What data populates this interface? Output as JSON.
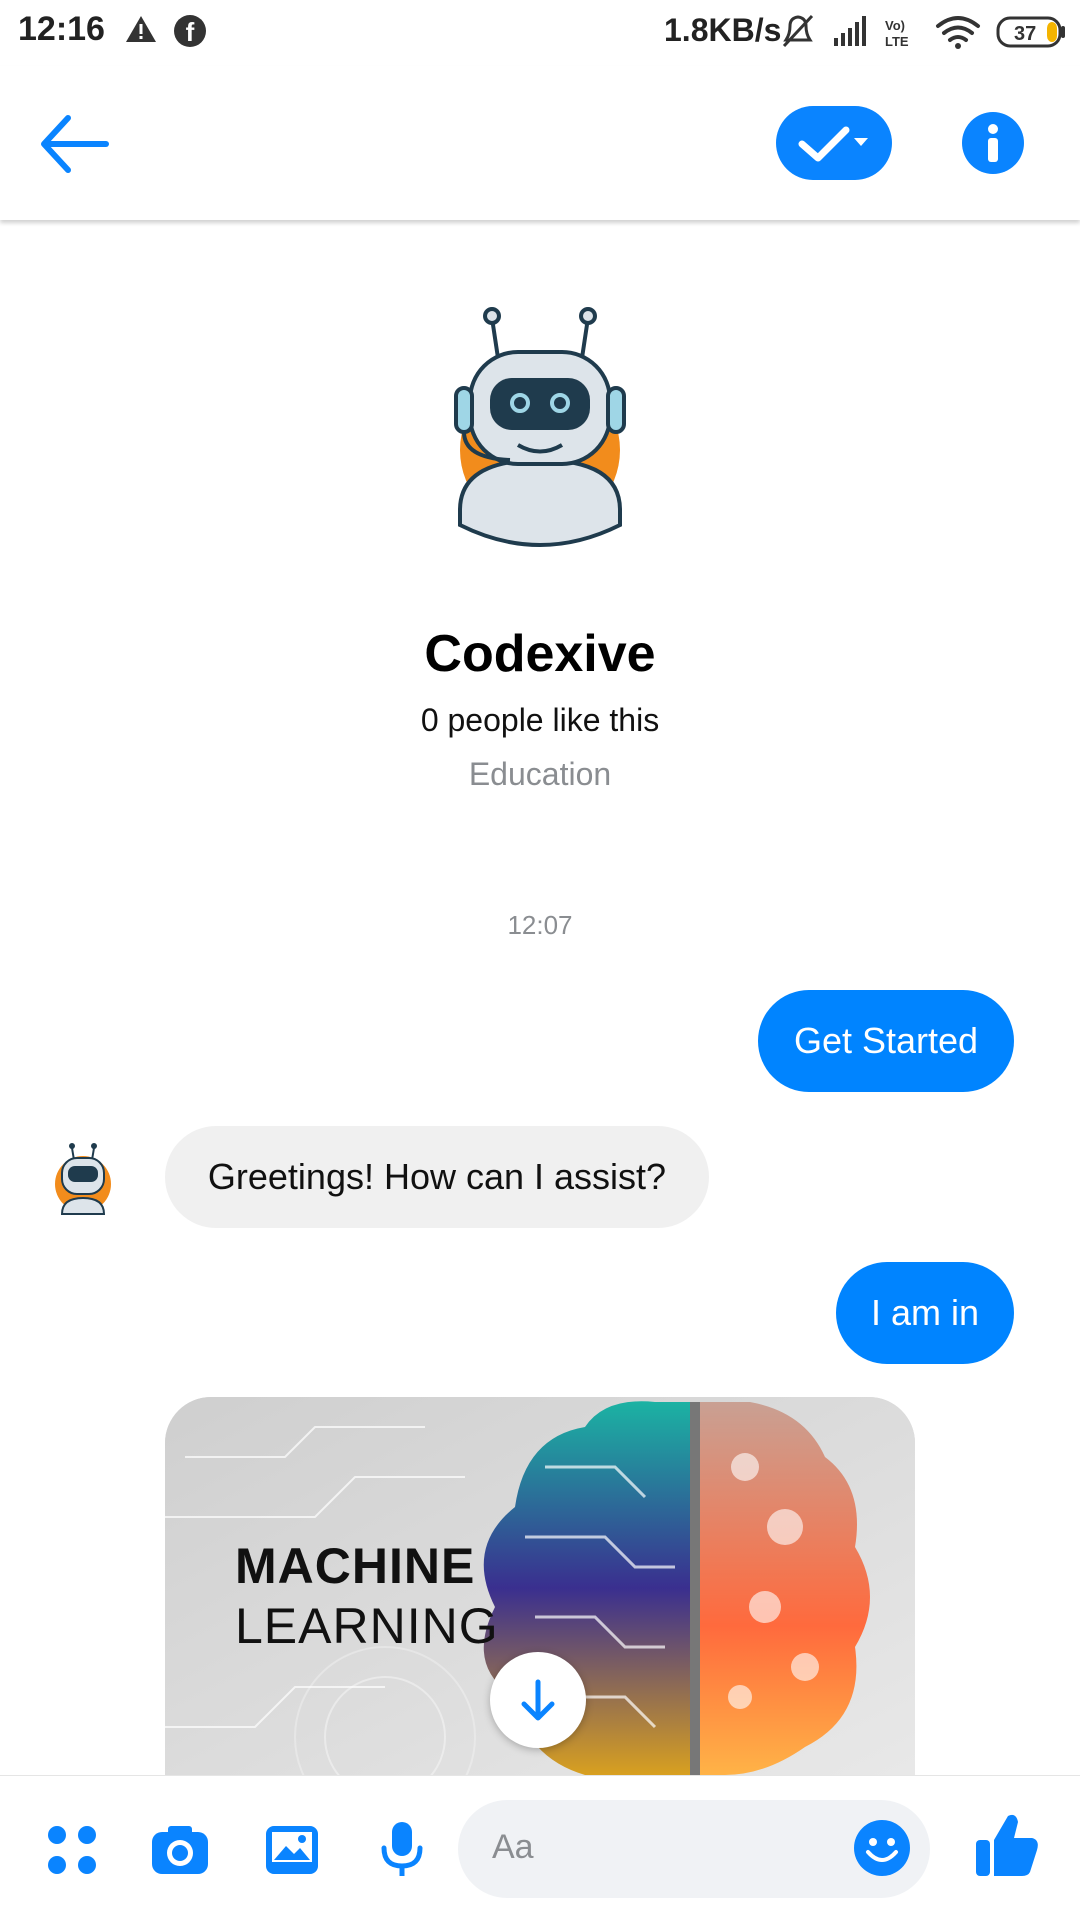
{
  "status_bar": {
    "time": "12:16",
    "speed": "1.8KB/s",
    "battery": "37",
    "network_label": "Vo) LTE"
  },
  "header": {
    "back_icon": "arrow-left-icon",
    "check_icon": "check-dropdown-icon",
    "info_icon": "info-icon",
    "accent_color": "#0a84ff"
  },
  "profile": {
    "name": "Codexive",
    "likes": "0 people like this",
    "category": "Education"
  },
  "conversation": {
    "timestamp": "12:07",
    "messages": [
      {
        "from": "me",
        "text": "Get Started"
      },
      {
        "from": "bot",
        "text": "Greetings! How can I assist?"
      },
      {
        "from": "me",
        "text": "I am in"
      }
    ],
    "image_card": {
      "line1": "MACHINE",
      "line2": "LEARNING"
    }
  },
  "composer": {
    "placeholder": "Aa",
    "icons": [
      "apps-icon",
      "camera-icon",
      "gallery-icon",
      "mic-icon",
      "emoji-icon",
      "thumbs-up-icon"
    ]
  }
}
